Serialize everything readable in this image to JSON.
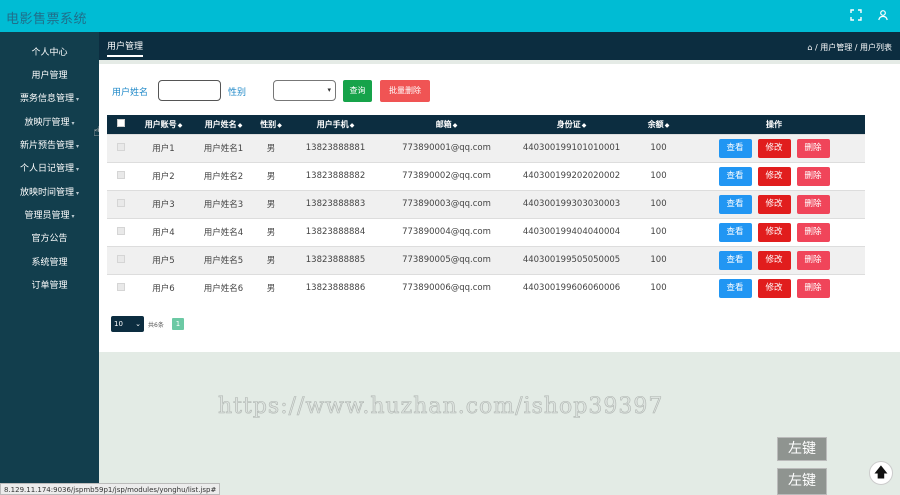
{
  "app": {
    "title": "电影售票系统"
  },
  "header": {
    "fullscreen_icon": "expand-icon",
    "user_icon": "user-icon"
  },
  "sidebar": {
    "items": [
      {
        "label": "个人中心",
        "has_arrow": false
      },
      {
        "label": "用户管理",
        "has_arrow": false
      },
      {
        "label": "票务信息管理",
        "has_arrow": true
      },
      {
        "label": "放映厅管理",
        "has_arrow": true
      },
      {
        "label": "新片预告管理",
        "has_arrow": true
      },
      {
        "label": "个人日记管理",
        "has_arrow": true
      },
      {
        "label": "放映时间管理",
        "has_arrow": true
      },
      {
        "label": "管理员管理",
        "has_arrow": true
      },
      {
        "label": "官方公告",
        "has_arrow": false
      },
      {
        "label": "系统管理",
        "has_arrow": false
      },
      {
        "label": "订单管理",
        "has_arrow": false
      }
    ]
  },
  "tabs": {
    "active": "用户管理"
  },
  "breadcrumb": {
    "home_icon": "home-icon",
    "text": "/ 用户管理 / 用户列表"
  },
  "search": {
    "name_label": "用户姓名",
    "name_value": "",
    "gender_label": "性别",
    "gender_value": "",
    "query_button": "查询",
    "batch_delete_button": "批量删除"
  },
  "table": {
    "columns": [
      "用户账号",
      "用户姓名",
      "性别",
      "用户手机",
      "邮箱",
      "身份证",
      "余额",
      "操作"
    ],
    "rows": [
      [
        "用户1",
        "用户姓名1",
        "男",
        "13823888881",
        "773890001@qq.com",
        "440300199101010001",
        "100"
      ],
      [
        "用户2",
        "用户姓名2",
        "男",
        "13823888882",
        "773890002@qq.com",
        "440300199202020002",
        "100"
      ],
      [
        "用户3",
        "用户姓名3",
        "男",
        "13823888883",
        "773890003@qq.com",
        "440300199303030003",
        "100"
      ],
      [
        "用户4",
        "用户姓名4",
        "男",
        "13823888884",
        "773890004@qq.com",
        "440300199404040004",
        "100"
      ],
      [
        "用户5",
        "用户姓名5",
        "男",
        "13823888885",
        "773890005@qq.com",
        "440300199505050005",
        "100"
      ],
      [
        "用户6",
        "用户姓名6",
        "男",
        "13823888886",
        "773890006@qq.com",
        "440300199606060006",
        "100"
      ]
    ],
    "actions": {
      "view": "查看",
      "edit": "修改",
      "delete": "删除"
    }
  },
  "pagination": {
    "page_size": "10",
    "total_label": "共6条",
    "current_page": "1"
  },
  "watermark": "https://www.huzhan.com/ishop39397",
  "overlay": {
    "left_click_1": "左键",
    "left_click_2": "左键"
  },
  "status_url": "8.129.11.174:9036/jspmb59p1/jsp/modules/yonghu/list.jsp#"
}
